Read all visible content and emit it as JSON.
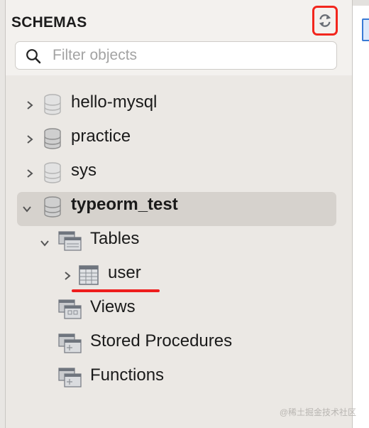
{
  "panel": {
    "title": "SCHEMAS",
    "refresh_icon": "refresh-icon",
    "accent_color": "#f2261d"
  },
  "filter": {
    "placeholder": "Filter objects",
    "value": "",
    "icon": "search-icon"
  },
  "schemas": [
    {
      "name": "hello-mysql",
      "expanded": false,
      "selected": false
    },
    {
      "name": "practice",
      "expanded": false,
      "selected": false
    },
    {
      "name": "sys",
      "expanded": false,
      "selected": false
    },
    {
      "name": "typeorm_test",
      "expanded": true,
      "selected": true
    }
  ],
  "typeorm_children": {
    "tables": {
      "label": "Tables",
      "expanded": true,
      "items": [
        {
          "name": "user",
          "expanded": false
        }
      ]
    },
    "views": {
      "label": "Views"
    },
    "stored_procedures": {
      "label": "Stored Procedures"
    },
    "functions": {
      "label": "Functions"
    }
  },
  "annotation": {
    "underline_color": "#ee1d1d"
  },
  "watermark": "@稀土掘金技术社区"
}
